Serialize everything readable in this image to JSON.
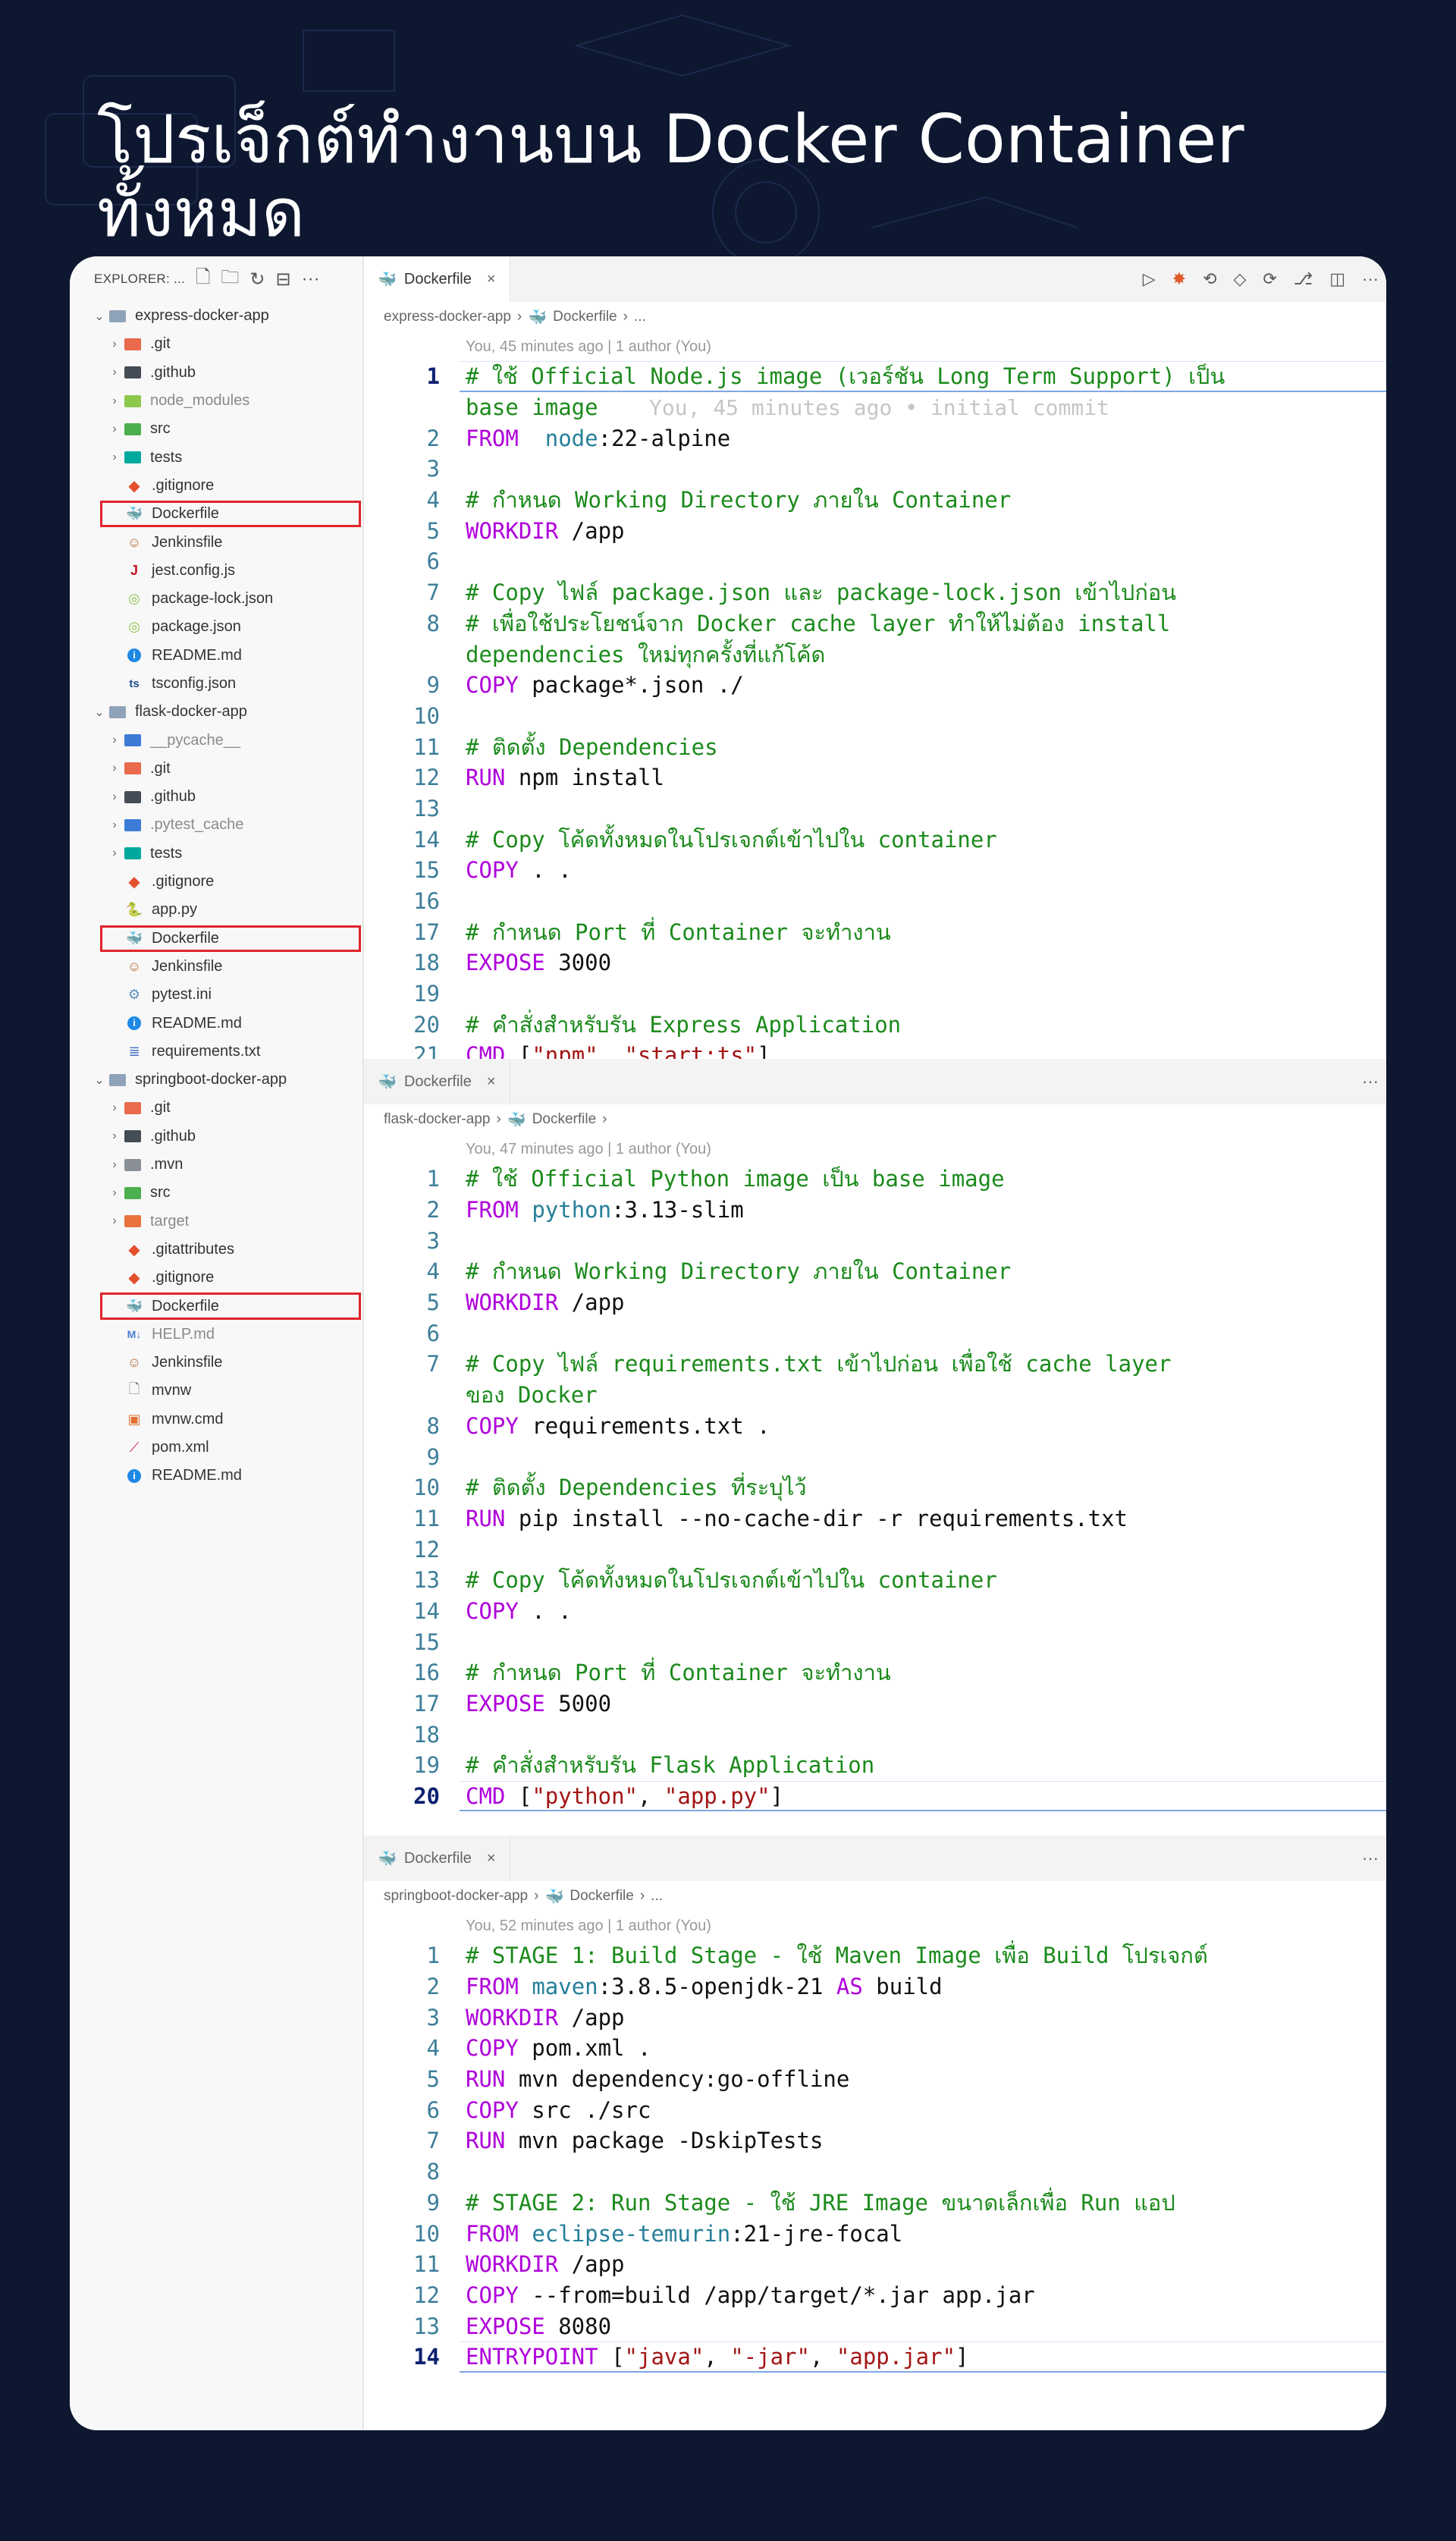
{
  "page_title": "โปรเจ็กต์ทำงานบน Docker Container ทั้งหมด",
  "explorer": {
    "header": "EXPLORER: ...",
    "more": "···",
    "tree": [
      {
        "type": "folder",
        "label": "express-docker-app",
        "open": true
      },
      {
        "type": "sub",
        "label": ".git",
        "icon": "git-folder-icon"
      },
      {
        "type": "sub",
        "label": ".github",
        "icon": "github-folder-icon"
      },
      {
        "type": "sub",
        "label": "node_modules",
        "icon": "node-folder-icon",
        "dim": true
      },
      {
        "type": "sub",
        "label": "src",
        "icon": "src-folder-icon"
      },
      {
        "type": "sub",
        "label": "tests",
        "icon": "tests-folder-icon"
      },
      {
        "type": "file",
        "label": ".gitignore",
        "icon": "git-icon"
      },
      {
        "type": "file",
        "label": "Dockerfile",
        "icon": "docker-icon",
        "selected": true
      },
      {
        "type": "file",
        "label": "Jenkinsfile",
        "icon": "jenkins-icon"
      },
      {
        "type": "file",
        "label": "jest.config.js",
        "icon": "jest-icon"
      },
      {
        "type": "file",
        "label": "package-lock.json",
        "icon": "npm-icon"
      },
      {
        "type": "file",
        "label": "package.json",
        "icon": "npm-icon"
      },
      {
        "type": "file",
        "label": "README.md",
        "icon": "info-icon"
      },
      {
        "type": "file",
        "label": "tsconfig.json",
        "icon": "tsconfig-icon"
      },
      {
        "type": "folder",
        "label": "flask-docker-app",
        "open": true
      },
      {
        "type": "sub",
        "label": "__pycache__",
        "icon": "python-folder-icon",
        "dim": true
      },
      {
        "type": "sub",
        "label": ".git",
        "icon": "git-folder-icon"
      },
      {
        "type": "sub",
        "label": ".github",
        "icon": "github-folder-icon"
      },
      {
        "type": "sub",
        "label": ".pytest_cache",
        "icon": "python-folder-icon",
        "dim": true
      },
      {
        "type": "sub",
        "label": "tests",
        "icon": "tests-folder-icon"
      },
      {
        "type": "file",
        "label": ".gitignore",
        "icon": "git-icon"
      },
      {
        "type": "file",
        "label": "app.py",
        "icon": "python-icon"
      },
      {
        "type": "file",
        "label": "Dockerfile",
        "icon": "docker-icon",
        "selected": true
      },
      {
        "type": "file",
        "label": "Jenkinsfile",
        "icon": "jenkins-icon"
      },
      {
        "type": "file",
        "label": "pytest.ini",
        "icon": "settings-icon"
      },
      {
        "type": "file",
        "label": "README.md",
        "icon": "info-icon"
      },
      {
        "type": "file",
        "label": "requirements.txt",
        "icon": "text-file-icon"
      },
      {
        "type": "folder",
        "label": "springboot-docker-app",
        "open": true
      },
      {
        "type": "sub",
        "label": ".git",
        "icon": "git-folder-icon"
      },
      {
        "type": "sub",
        "label": ".github",
        "icon": "github-folder-icon"
      },
      {
        "type": "sub",
        "label": ".mvn",
        "icon": "folder-icon"
      },
      {
        "type": "sub",
        "label": "src",
        "icon": "src-folder-icon"
      },
      {
        "type": "sub",
        "label": "target",
        "icon": "target-folder-icon",
        "dim": true
      },
      {
        "type": "file",
        "label": ".gitattributes",
        "icon": "git-icon"
      },
      {
        "type": "file",
        "label": ".gitignore",
        "icon": "git-icon"
      },
      {
        "type": "file",
        "label": "Dockerfile",
        "icon": "docker-icon",
        "selected": true
      },
      {
        "type": "file",
        "label": "HELP.md",
        "icon": "markdown-icon",
        "dim": true
      },
      {
        "type": "file",
        "label": "Jenkinsfile",
        "icon": "jenkins-icon"
      },
      {
        "type": "file",
        "label": "mvnw",
        "icon": "file-icon"
      },
      {
        "type": "file",
        "label": "mvnw.cmd",
        "icon": "cmd-icon"
      },
      {
        "type": "file",
        "label": "pom.xml",
        "icon": "maven-icon"
      },
      {
        "type": "file",
        "label": "README.md",
        "icon": "info-icon"
      }
    ]
  },
  "panes": [
    {
      "tab": "Dockerfile",
      "breadcrumb": [
        "express-docker-app",
        "Dockerfile",
        "..."
      ],
      "blame": "You, 45 minutes ago | 1 author (You)",
      "active_line": 1,
      "lines": [
        {
          "n": "1",
          "t": [
            [
              "cm",
              "# ใช้ Official Node.js image (เวอร์ชัน Long Term Support) เป็น"
            ]
          ]
        },
        {
          "n": "",
          "t": [
            [
              "cm",
              "base image"
            ],
            [
              "ghost",
              "    You, 45 minutes ago • initial commit"
            ]
          ]
        },
        {
          "n": "2",
          "t": [
            [
              "kw",
              "FROM"
            ],
            [
              "",
              "  "
            ],
            [
              "im",
              "node"
            ],
            [
              "",
              ":22-alpine"
            ]
          ]
        },
        {
          "n": "3",
          "t": []
        },
        {
          "n": "4",
          "t": [
            [
              "cm",
              "# กำหนด Working Directory ภายใน Container"
            ]
          ]
        },
        {
          "n": "5",
          "t": [
            [
              "kw",
              "WORKDIR"
            ],
            [
              "",
              " /app"
            ]
          ]
        },
        {
          "n": "6",
          "t": []
        },
        {
          "n": "7",
          "t": [
            [
              "cm",
              "# Copy ไฟล์ package.json และ package-lock.json เข้าไปก่อน"
            ]
          ]
        },
        {
          "n": "8",
          "t": [
            [
              "cm",
              "# เพื่อใช้ประโยชน์จาก Docker cache layer ทำให้ไม่ต้อง install"
            ]
          ]
        },
        {
          "n": "",
          "t": [
            [
              "cm",
              "dependencies ใหม่ทุกครั้งที่แก้โค้ด"
            ]
          ]
        },
        {
          "n": "9",
          "t": [
            [
              "kw",
              "COPY"
            ],
            [
              "",
              " package*.json ./"
            ]
          ]
        },
        {
          "n": "10",
          "t": []
        },
        {
          "n": "11",
          "t": [
            [
              "cm",
              "# ติดตั้ง Dependencies"
            ]
          ]
        },
        {
          "n": "12",
          "t": [
            [
              "kw",
              "RUN"
            ],
            [
              "",
              " npm install"
            ]
          ]
        },
        {
          "n": "13",
          "t": []
        },
        {
          "n": "14",
          "t": [
            [
              "cm",
              "# Copy โค้ดทั้งหมดในโปรเจกต์เข้าไปใน container"
            ]
          ]
        },
        {
          "n": "15",
          "t": [
            [
              "kw",
              "COPY"
            ],
            [
              "",
              " . ."
            ]
          ]
        },
        {
          "n": "16",
          "t": []
        },
        {
          "n": "17",
          "t": [
            [
              "cm",
              "# กำหนด Port ที่ Container จะทำงาน"
            ]
          ]
        },
        {
          "n": "18",
          "t": [
            [
              "kw",
              "EXPOSE"
            ],
            [
              "",
              " 3000"
            ]
          ]
        },
        {
          "n": "19",
          "t": []
        },
        {
          "n": "20",
          "t": [
            [
              "cm",
              "# คำสั่งสำหรับรัน Express Application"
            ]
          ]
        },
        {
          "n": "21",
          "t": [
            [
              "kw",
              "CMD"
            ],
            [
              "",
              " ["
            ],
            [
              "st",
              "\"npm\""
            ],
            [
              "",
              ", "
            ],
            [
              "st",
              "\"start:ts\""
            ],
            [
              "",
              "]"
            ]
          ]
        }
      ]
    },
    {
      "tab": "Dockerfile",
      "breadcrumb": [
        "flask-docker-app",
        "Dockerfile",
        ""
      ],
      "blame": "You, 47 minutes ago | 1 author (You)",
      "active_line": 20,
      "lines": [
        {
          "n": "1",
          "t": [
            [
              "cm",
              "# ใช้ Official Python image เป็น base image"
            ]
          ]
        },
        {
          "n": "2",
          "t": [
            [
              "kw",
              "FROM"
            ],
            [
              "",
              " "
            ],
            [
              "im",
              "python"
            ],
            [
              "",
              ":3.13-slim"
            ]
          ]
        },
        {
          "n": "3",
          "t": []
        },
        {
          "n": "4",
          "t": [
            [
              "cm",
              "# กำหนด Working Directory ภายใน Container"
            ]
          ]
        },
        {
          "n": "5",
          "t": [
            [
              "kw",
              "WORKDIR"
            ],
            [
              "",
              " /app"
            ]
          ]
        },
        {
          "n": "6",
          "t": []
        },
        {
          "n": "7",
          "t": [
            [
              "cm",
              "# Copy ไฟล์ requirements.txt เข้าไปก่อน เพื่อใช้ cache layer"
            ]
          ]
        },
        {
          "n": "",
          "t": [
            [
              "cm",
              "ของ Docker"
            ]
          ]
        },
        {
          "n": "8",
          "t": [
            [
              "kw",
              "COPY"
            ],
            [
              "",
              " requirements.txt ."
            ]
          ]
        },
        {
          "n": "9",
          "t": []
        },
        {
          "n": "10",
          "t": [
            [
              "cm",
              "# ติดตั้ง Dependencies ที่ระบุไว้"
            ]
          ]
        },
        {
          "n": "11",
          "t": [
            [
              "kw",
              "RUN"
            ],
            [
              "",
              " pip install --no-cache-dir -r requirements.txt"
            ]
          ]
        },
        {
          "n": "12",
          "t": []
        },
        {
          "n": "13",
          "t": [
            [
              "cm",
              "# Copy โค้ดทั้งหมดในโปรเจกต์เข้าไปใน container"
            ]
          ]
        },
        {
          "n": "14",
          "t": [
            [
              "kw",
              "COPY"
            ],
            [
              "",
              " . ."
            ]
          ]
        },
        {
          "n": "15",
          "t": []
        },
        {
          "n": "16",
          "t": [
            [
              "cm",
              "# กำหนด Port ที่ Container จะทำงาน"
            ]
          ]
        },
        {
          "n": "17",
          "t": [
            [
              "kw",
              "EXPOSE"
            ],
            [
              "",
              " 5000"
            ]
          ]
        },
        {
          "n": "18",
          "t": []
        },
        {
          "n": "19",
          "t": [
            [
              "cm",
              "# คำสั่งสำหรับรัน Flask Application"
            ]
          ]
        },
        {
          "n": "20",
          "t": [
            [
              "kw",
              "CMD"
            ],
            [
              "",
              " ["
            ],
            [
              "st",
              "\"python\""
            ],
            [
              "",
              ", "
            ],
            [
              "st",
              "\"app.py\""
            ],
            [
              "",
              "]"
            ]
          ]
        }
      ]
    },
    {
      "tab": "Dockerfile",
      "breadcrumb": [
        "springboot-docker-app",
        "Dockerfile",
        "..."
      ],
      "blame": "You, 52 minutes ago | 1 author (You)",
      "active_line": 14,
      "lines": [
        {
          "n": "1",
          "t": [
            [
              "cm",
              "# STAGE 1: Build Stage - ใช้ Maven Image เพื่อ Build โปรเจกต์"
            ]
          ]
        },
        {
          "n": "2",
          "t": [
            [
              "kw",
              "FROM"
            ],
            [
              "",
              " "
            ],
            [
              "im",
              "maven"
            ],
            [
              "",
              ":3.8.5-openjdk-21 "
            ],
            [
              "kw",
              "AS"
            ],
            [
              "",
              " build"
            ]
          ]
        },
        {
          "n": "3",
          "t": [
            [
              "kw",
              "WORKDIR"
            ],
            [
              "",
              " /app"
            ]
          ]
        },
        {
          "n": "4",
          "t": [
            [
              "kw",
              "COPY"
            ],
            [
              "",
              " pom.xml ."
            ]
          ]
        },
        {
          "n": "5",
          "t": [
            [
              "kw",
              "RUN"
            ],
            [
              "",
              " mvn dependency:go-offline"
            ]
          ]
        },
        {
          "n": "6",
          "t": [
            [
              "kw",
              "COPY"
            ],
            [
              "",
              " src ./src"
            ]
          ]
        },
        {
          "n": "7",
          "t": [
            [
              "kw",
              "RUN"
            ],
            [
              "",
              " mvn package -DskipTests"
            ]
          ]
        },
        {
          "n": "8",
          "t": []
        },
        {
          "n": "9",
          "t": [
            [
              "cm",
              "# STAGE 2: Run Stage - ใช้ JRE Image ขนาดเล็กเพื่อ Run แอป"
            ]
          ]
        },
        {
          "n": "10",
          "t": [
            [
              "kw",
              "FROM"
            ],
            [
              "",
              " "
            ],
            [
              "im",
              "eclipse-temurin"
            ],
            [
              "",
              ":21-jre-focal"
            ]
          ]
        },
        {
          "n": "11",
          "t": [
            [
              "kw",
              "WORKDIR"
            ],
            [
              "",
              " /app"
            ]
          ]
        },
        {
          "n": "12",
          "t": [
            [
              "kw",
              "COPY"
            ],
            [
              "",
              " --from=build /app/target/*.jar app.jar"
            ]
          ]
        },
        {
          "n": "13",
          "t": [
            [
              "kw",
              "EXPOSE"
            ],
            [
              "",
              " 8080"
            ]
          ]
        },
        {
          "n": "14",
          "t": [
            [
              "kw",
              "ENTRYPOINT"
            ],
            [
              "",
              " ["
            ],
            [
              "st",
              "\"java\""
            ],
            [
              "",
              ", "
            ],
            [
              "st",
              "\"-jar\""
            ],
            [
              "",
              ", "
            ],
            [
              "st",
              "\"app.jar\""
            ],
            [
              "",
              "]"
            ]
          ]
        }
      ]
    }
  ],
  "colors": {
    "background": "#0d1730",
    "selection_border": "#e0242a",
    "comment": "#1b8a1b",
    "keyword": "#af00db",
    "image_name": "#267f99",
    "string": "#a31515",
    "line_number": "#3d7e9a"
  }
}
